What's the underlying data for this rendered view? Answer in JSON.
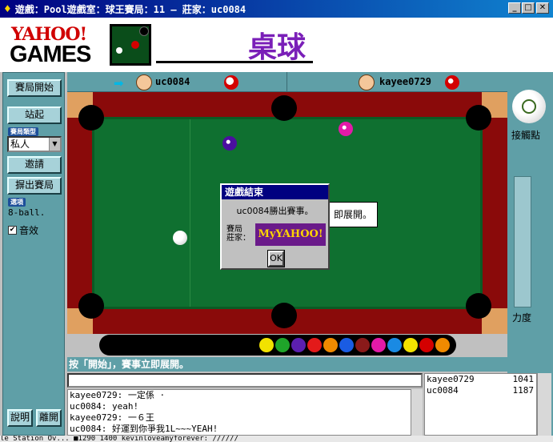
{
  "window": {
    "title": "遊戲：Pool遊戲室：球王賽局：11 — 莊家：uc0084",
    "min": "_",
    "max": "□",
    "close": "✕"
  },
  "header": {
    "logo_top": "YAHOO!",
    "logo_bottom": "GAMES",
    "game_name": "桌球"
  },
  "left": {
    "start_button": "賽局開始",
    "stand_button": "站起",
    "type_label": "賽局類型",
    "type_value": "私人",
    "invite_button": "邀請",
    "kick_button": "摒出賽局",
    "option_label": "選項",
    "game_type": "8-ball.",
    "sound_label": "音效",
    "help_button": "說明",
    "leave_button": "離開"
  },
  "players_bar": {
    "p1": "uc0084",
    "p2": "kayee0729"
  },
  "right": {
    "contact_label": "接觸點",
    "power_label": "力度"
  },
  "dialog": {
    "title": "遊戲結束",
    "message": "uc0084勝出賽事。",
    "sponsor_label": "賽局\n莊家：",
    "sponsor_banner": "MyYAHOO!",
    "ok": "OK"
  },
  "tooltip": "即展開。",
  "status_bar": "按「開始」，賽事立即展開。",
  "chat": {
    "input_value": "",
    "lines": [
      "kayee0729: 一定係 ·",
      "uc0084: yeah!",
      "kayee0729: 一６王",
      "uc0084: 好運到你爭我1L~~~YEAH!"
    ]
  },
  "player_list": [
    {
      "name": "kayee0729",
      "score": "1041"
    },
    {
      "name": "uc0084",
      "score": "1187"
    }
  ],
  "bottom_strip": "le Station Ov...  ■1290 1400  kevinloveamyforever: //////",
  "colors": {
    "panel_teal": "#5f9fa7",
    "felt_green": "#0f7030",
    "rail_red": "#8a0a0a",
    "title_purple": "#7a1fb8"
  }
}
